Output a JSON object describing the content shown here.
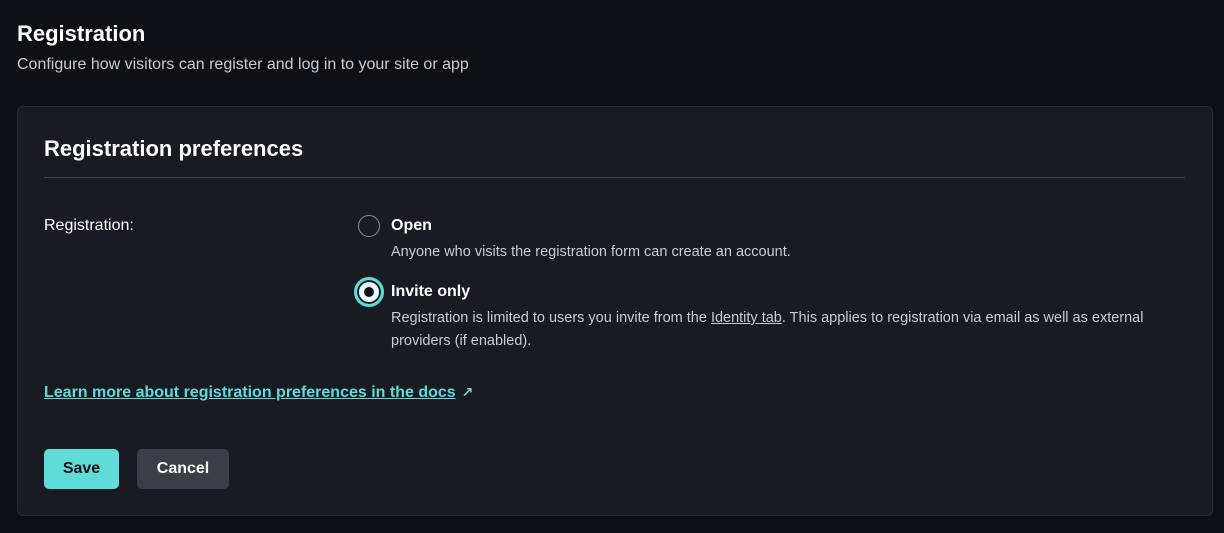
{
  "header": {
    "title": "Registration",
    "subtitle": "Configure how visitors can register and log in to your site or app"
  },
  "card": {
    "title": "Registration preferences",
    "field_label": "Registration:",
    "options": [
      {
        "label": "Open",
        "description": "Anyone who visits the registration form can create an account.",
        "selected": false
      },
      {
        "label": "Invite only",
        "description_before": "Registration is limited to users you invite from the ",
        "description_link": "Identity tab",
        "description_after": ". This applies to registration via email as well as external providers (if enabled).",
        "selected": true
      }
    ],
    "docs_link": "Learn more about registration preferences in the docs",
    "docs_link_icon": "external-link-icon"
  },
  "buttons": {
    "save_label": "Save",
    "cancel_label": "Cancel"
  },
  "colors": {
    "background": "#0e1015",
    "card": "#181b22",
    "accent": "#5fdcd8",
    "cancel_button": "#3a3e47"
  }
}
